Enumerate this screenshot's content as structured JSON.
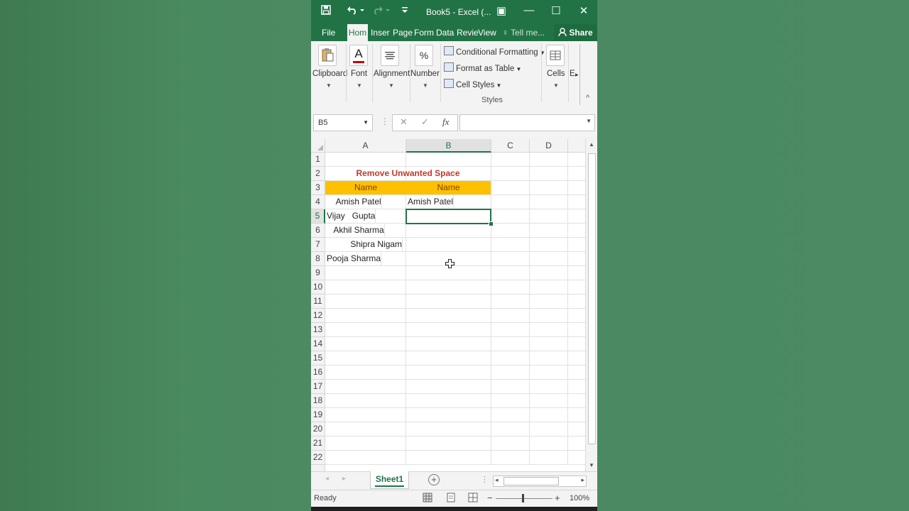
{
  "window": {
    "title": "Book5 - Excel (...",
    "min_glyph": "—",
    "max_glyph": "☐",
    "close_glyph": "✕",
    "restore_glyph": "▣"
  },
  "quick_access": {
    "save_icon": "save-icon",
    "undo_icon": "undo-icon",
    "redo_icon": "redo-icon",
    "customize_icon": "customize-icon"
  },
  "tabs": [
    "File",
    "Hom",
    "Inser",
    "Page",
    "Form",
    "Data",
    "Revie",
    "View"
  ],
  "tell_me": "Tell me...",
  "share": "Share",
  "ribbon": {
    "clipboard": "Clipboard",
    "font": "Font",
    "alignment": "Alignment",
    "number": "Number",
    "number_glyph": "%",
    "font_glyph": "A",
    "conditional_formatting": "Conditional Formatting",
    "format_as_table": "Format as Table",
    "cell_styles": "Cell Styles",
    "styles_group": "Styles",
    "cells": "Cells",
    "editing_partial": "E",
    "collapse_glyph": "^"
  },
  "formula_bar": {
    "name_box": "B5",
    "cancel_glyph": "✕",
    "enter_glyph": "✓",
    "fx": "fx",
    "value": ""
  },
  "columns": [
    "A",
    "B",
    "C",
    "D"
  ],
  "rows": [
    "1",
    "2",
    "3",
    "4",
    "5",
    "6",
    "7",
    "8",
    "9",
    "10",
    "11",
    "12",
    "13",
    "14",
    "15",
    "16",
    "17",
    "18",
    "19",
    "20",
    "21",
    "22"
  ],
  "cells": {
    "title": "Remove Unwanted Space",
    "header_a": "Name",
    "header_b": "Name",
    "a4": "    Amish Patel",
    "b4": "Amish Patel",
    "a5": "Vijay   Gupta",
    "a6": "   Akhil Sharma",
    "a7": "          Shipra Nigam",
    "a8": "Pooja Sharma"
  },
  "sheet": {
    "tab": "Sheet1",
    "add_glyph": "+"
  },
  "status": {
    "ready": "Ready",
    "zoom": "100%"
  },
  "colors": {
    "excel_green": "#217346",
    "header_fill": "#ffc000",
    "title_red": "#c0392b"
  }
}
